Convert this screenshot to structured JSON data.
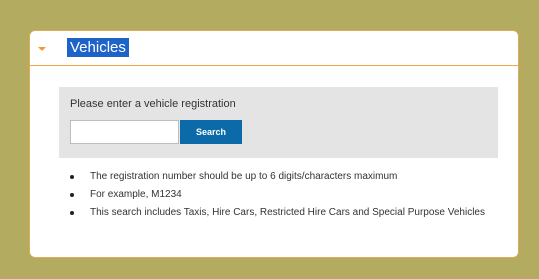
{
  "panel": {
    "title": "Vehicles",
    "chevron_icon": "chevron-down-icon"
  },
  "search": {
    "label": "Please enter a vehicle registration",
    "input_value": "",
    "input_placeholder": "",
    "button_label": "Search"
  },
  "notes": [
    "The registration number should be up to 6 digits/characters maximum",
    "For example, M1234",
    "This search includes Taxis, Hire Cars, Restricted Hire Cars and Special Purpose Vehicles"
  ],
  "colors": {
    "page_background": "#b3ab5f",
    "accent_orange": "#f29a2e",
    "title_highlight": "#1e64c8",
    "button": "#0c6aa8"
  }
}
